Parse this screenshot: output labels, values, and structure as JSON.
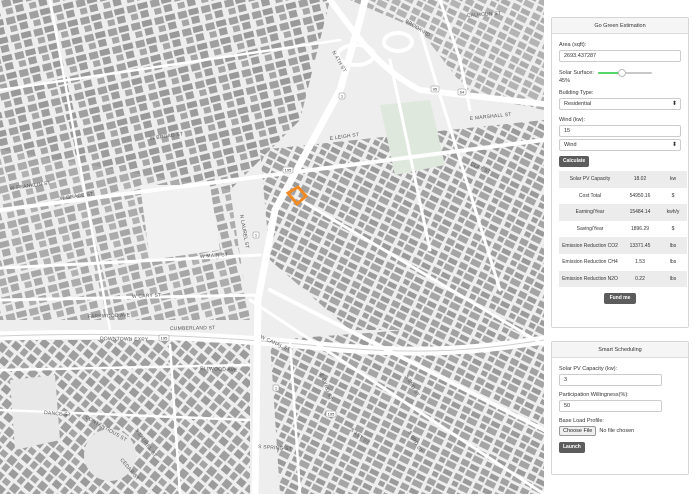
{
  "map": {
    "street_labels": [
      "BROOK RD",
      "W BROAD ST",
      "N 4TH ST",
      "E MARSHALL ST",
      "E LEIGH ST",
      "W FRANKLIN ST",
      "W GRACE ST",
      "W MAIN ST",
      "W CARY ST",
      "N LAUREL ST",
      "FARKWOOD AVE",
      "CUMBERLAND ST",
      "DOWNTOWN EXPY",
      "W CANAL ST",
      "ELLWOOD AVE",
      "DANCE ST",
      "CONTENTIOUS ST",
      "S LAUREL ST",
      "CEDAR ST",
      "S SPRING ST",
      "E BYRD ST",
      "S 2ND ST",
      "CLAY ST",
      "CALHOUN ST",
      "S 1ST ST",
      "S 3RD ST"
    ],
    "route_shields": [
      "1",
      "1",
      "95",
      "64",
      "195",
      "1",
      "195",
      "195"
    ],
    "highlight_color": "#f08a24"
  },
  "green": {
    "title": "Go Green Estimation",
    "area_label": "Area (sqft):",
    "area_value": "2693.437287",
    "solar_label": "Solar Surface:",
    "solar_percent_text": "45%",
    "solar_level": 0.45,
    "building_label": "Building Type:",
    "building_value": "Residential",
    "wind_label": "Wind (kw):",
    "wind_value": "15",
    "wind_select": "Wind",
    "calculate_label": "Calculate",
    "results": [
      {
        "name": "Solar PV Capacity",
        "value": "18.02",
        "unit": "kw"
      },
      {
        "name": "Cost Total",
        "value": "54950.16",
        "unit": "$"
      },
      {
        "name": "Earning/Year",
        "value": "15484.14",
        "unit": "kwh/y"
      },
      {
        "name": "Saving/Year",
        "value": "1896.29",
        "unit": "$"
      },
      {
        "name": "Emission Reduction CO2",
        "value": "13371.45",
        "unit": "lbs"
      },
      {
        "name": "Emission Reduction CH4",
        "value": "1.53",
        "unit": "lbs"
      },
      {
        "name": "Emission Reduction N2O",
        "value": "0.22",
        "unit": "lbs"
      }
    ],
    "fund_label": "Fund me"
  },
  "scheduling": {
    "title": "Smart Scheduling",
    "capacity_label": "Solar PV Capacity (kw):",
    "capacity_value": "3",
    "participation_label": "Participation Willingness(%):",
    "participation_value": "50",
    "load_label": "Base Load Profile:",
    "choose_file_label": "Choose File",
    "no_file_text": "No file chosen",
    "launch_label": "Launch"
  },
  "colors": {
    "accent_green": "#55d66b",
    "button_gray": "#5c5c5c",
    "building_gray": "#9e9e9e",
    "map_background": "#eeeeee"
  }
}
